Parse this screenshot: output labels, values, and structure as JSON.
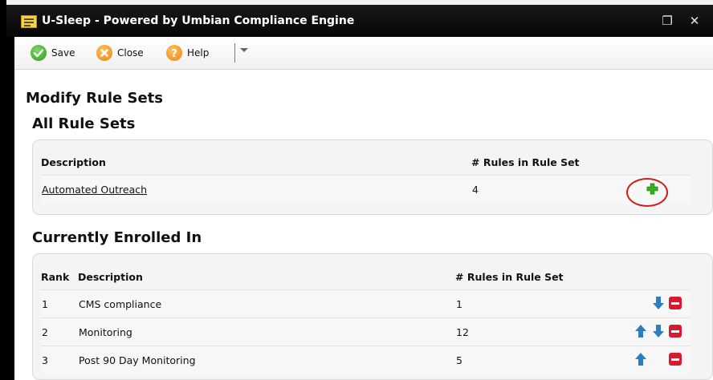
{
  "window": {
    "title": "U-Sleep - Powered by Umbian Compliance Engine",
    "restore_symbol": "❐",
    "close_symbol": "✕"
  },
  "toolbar": {
    "save_label": "Save",
    "close_label": "Close",
    "help_label": "Help"
  },
  "page": {
    "title": "Modify Rule Sets"
  },
  "all_rule_sets": {
    "title": "All Rule Sets",
    "columns": {
      "description": "Description",
      "rules": "# Rules in Rule Set"
    },
    "rows": [
      {
        "description": "Automated Outreach",
        "rules": "4",
        "action": "add"
      }
    ]
  },
  "enrolled": {
    "title": "Currently Enrolled In",
    "columns": {
      "rank": "Rank",
      "description": "Description",
      "rules": "# Rules in Rule Set"
    },
    "rows": [
      {
        "rank": "1",
        "description": "CMS compliance",
        "rules": "1",
        "move_up": false,
        "move_down": true
      },
      {
        "rank": "2",
        "description": "Monitoring",
        "rules": "12",
        "move_up": true,
        "move_down": true
      },
      {
        "rank": "3",
        "description": "Post 90 Day Monitoring",
        "rules": "5",
        "move_up": true,
        "move_down": false
      }
    ]
  },
  "colors": {
    "titlebar": "#000000",
    "accent_arrow": "#2a7fbf",
    "remove_red": "#d81a2e",
    "add_green": "#35b21e",
    "highlight_ring": "#d01a1a"
  }
}
